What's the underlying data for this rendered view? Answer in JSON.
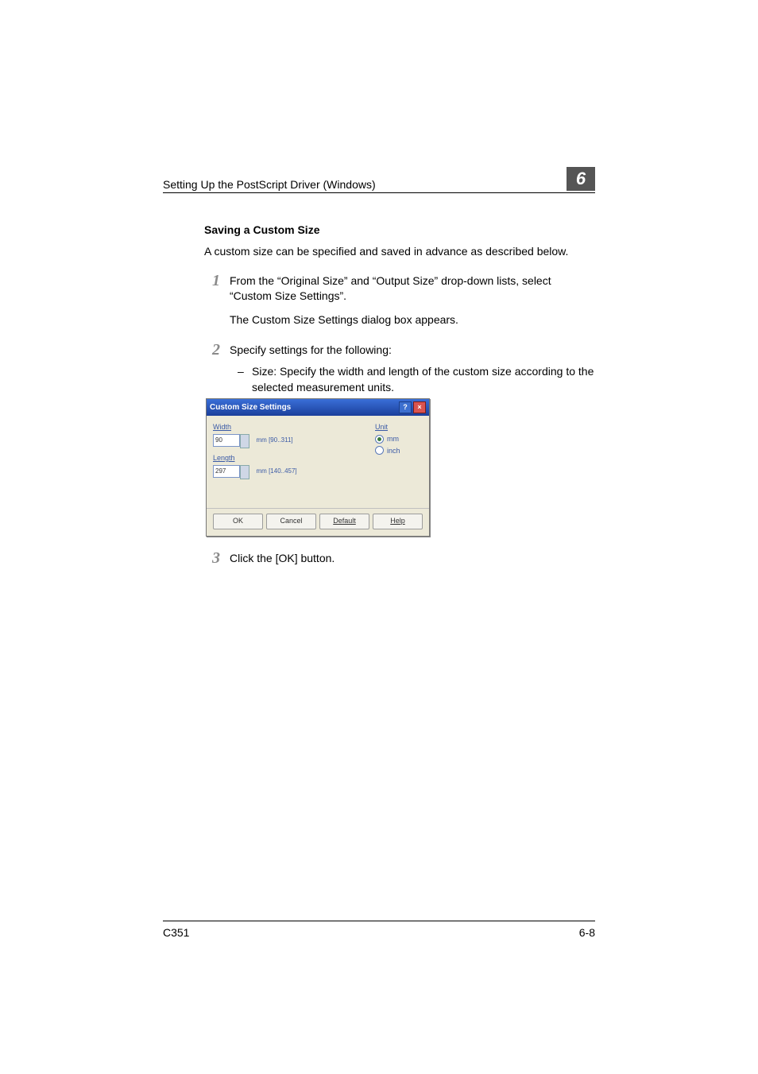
{
  "header": {
    "running_title": "Setting Up the PostScript Driver (Windows)",
    "chapter_number": "6"
  },
  "section": {
    "heading": "Saving a Custom Size",
    "intro": "A custom size can be specified and saved in advance as described below."
  },
  "steps": [
    {
      "num": "1",
      "text": "From the “Original Size” and “Output Size” drop-down lists, select “Custom Size Settings”.",
      "subtext": "The Custom Size Settings dialog box appears."
    },
    {
      "num": "2",
      "text": "Specify settings for the following:",
      "bullets": [
        "Size: Specify the width and length of the custom size according to the selected measurement units."
      ]
    },
    {
      "num": "3",
      "text": "Click the [OK] button."
    }
  ],
  "dialog": {
    "title": "Custom Size Settings",
    "width_label": "Width",
    "width_value": "90",
    "width_range": "mm [90..311]",
    "length_label": "Length",
    "length_value": "297",
    "length_range": "mm [140..457]",
    "unit_label": "Unit",
    "unit_mm": "mm",
    "unit_inch": "inch",
    "buttons": {
      "ok": "OK",
      "cancel": "Cancel",
      "default": "Default",
      "help": "Help"
    }
  },
  "footer": {
    "model": "C351",
    "page": "6-8"
  }
}
